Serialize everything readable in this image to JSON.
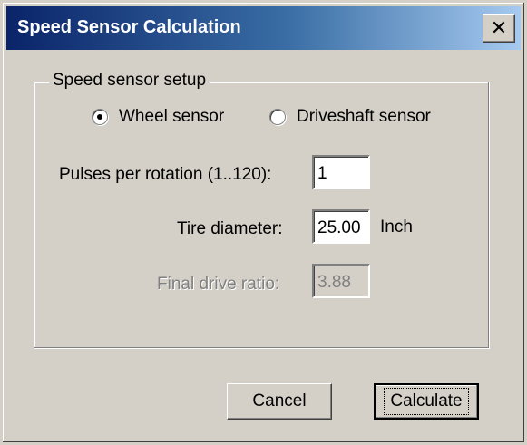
{
  "window": {
    "title": "Speed Sensor Calculation",
    "close_label": "✕"
  },
  "setup_group": {
    "label": "Speed sensor setup",
    "options": [
      {
        "label": "Wheel sensor",
        "selected": true
      },
      {
        "label": "Driveshaft sensor",
        "selected": false
      }
    ]
  },
  "fields": {
    "pulses": {
      "label": "Pulses per rotation (1..120):",
      "value": "1"
    },
    "tire": {
      "label": "Tire diameter:",
      "value": "25.00",
      "unit": "Inch"
    },
    "final_drive": {
      "label": "Final drive ratio:",
      "value": "3.88",
      "disabled": true
    }
  },
  "buttons": {
    "cancel": "Cancel",
    "calculate": "Calculate"
  },
  "colors": {
    "dialog_bg": "#d4d0c8",
    "titlebar_start": "#0a246a",
    "titlebar_end": "#a6caf0"
  }
}
